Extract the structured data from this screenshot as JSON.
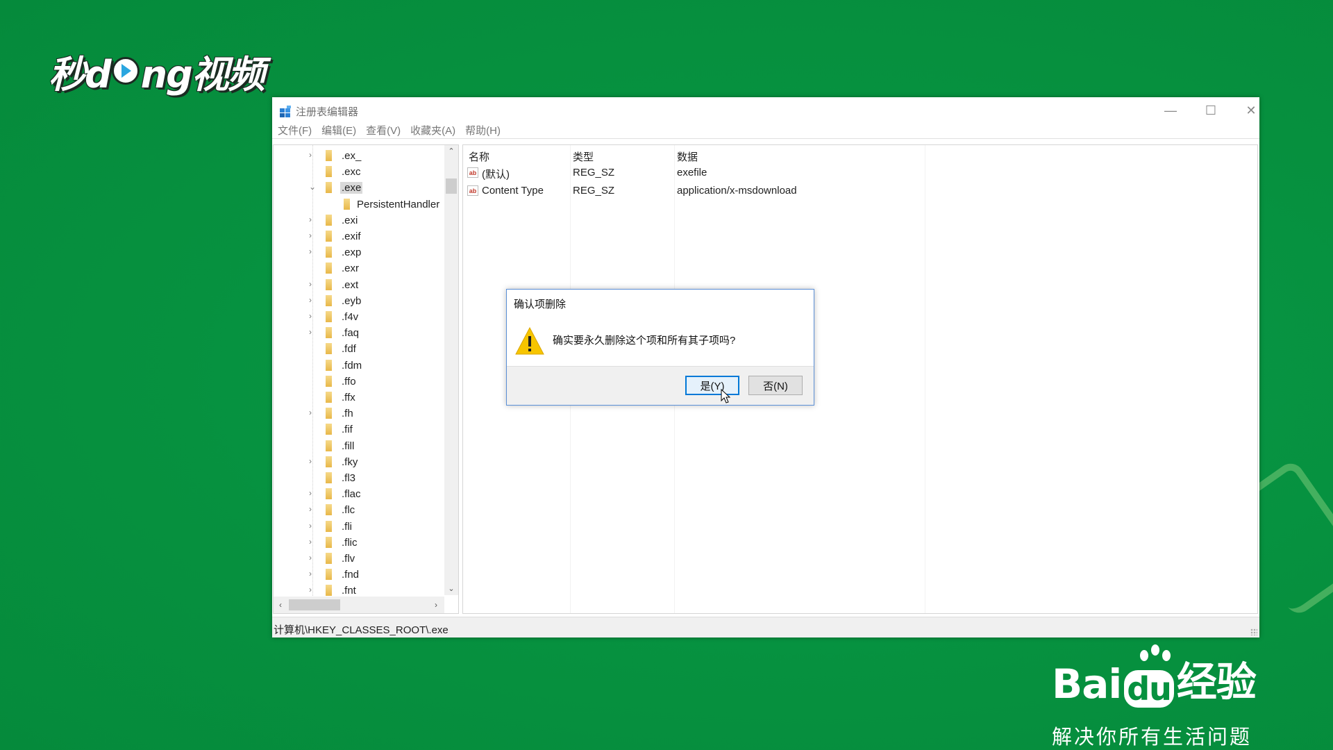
{
  "watermark": {
    "brand_left": "秒d",
    "brand_mid": "ng视频",
    "baidu_text": "Bai",
    "baidu_paw_text": "du",
    "baidu_suffix": "经验",
    "baidu_slogan": "解决你所有生活问题"
  },
  "window": {
    "title": "注册表编辑器",
    "controls": {
      "minimize": "—",
      "maximize": "☐",
      "close": "✕"
    },
    "menu": [
      "文件(F)",
      "编辑(E)",
      "查看(V)",
      "收藏夹(A)",
      "帮助(H)"
    ]
  },
  "tree": {
    "items": [
      {
        "label": ".ex_",
        "expander": "›"
      },
      {
        "label": ".exc",
        "expander": ""
      },
      {
        "label": ".exe",
        "expander": "⌄",
        "selected": true
      },
      {
        "label": "PersistentHandler",
        "expander": "",
        "child": true
      },
      {
        "label": ".exi",
        "expander": "›"
      },
      {
        "label": ".exif",
        "expander": "›"
      },
      {
        "label": ".exp",
        "expander": "›"
      },
      {
        "label": ".exr",
        "expander": ""
      },
      {
        "label": ".ext",
        "expander": "›"
      },
      {
        "label": ".eyb",
        "expander": "›"
      },
      {
        "label": ".f4v",
        "expander": "›"
      },
      {
        "label": ".faq",
        "expander": "›"
      },
      {
        "label": ".fdf",
        "expander": ""
      },
      {
        "label": ".fdm",
        "expander": ""
      },
      {
        "label": ".ffo",
        "expander": ""
      },
      {
        "label": ".ffx",
        "expander": ""
      },
      {
        "label": ".fh",
        "expander": "›"
      },
      {
        "label": ".fif",
        "expander": ""
      },
      {
        "label": ".fill",
        "expander": ""
      },
      {
        "label": ".fky",
        "expander": "›"
      },
      {
        "label": ".fl3",
        "expander": ""
      },
      {
        "label": ".flac",
        "expander": "›"
      },
      {
        "label": ".flc",
        "expander": "›"
      },
      {
        "label": ".fli",
        "expander": "›"
      },
      {
        "label": ".flic",
        "expander": "›"
      },
      {
        "label": ".flv",
        "expander": "›"
      },
      {
        "label": ".fnd",
        "expander": "›"
      },
      {
        "label": ".fnt",
        "expander": "›"
      }
    ],
    "scroll_up": "⌃",
    "scroll_down": "⌄",
    "scroll_left": "‹",
    "scroll_right": "›"
  },
  "list": {
    "headers": {
      "name": "名称",
      "type": "类型",
      "data": "数据"
    },
    "rows": [
      {
        "icon": "ab",
        "name": "(默认)",
        "type": "REG_SZ",
        "data": "exefile"
      },
      {
        "icon": "ab",
        "name": "Content Type",
        "type": "REG_SZ",
        "data": "application/x-msdownload"
      }
    ]
  },
  "status": {
    "path": "计算机\\HKEY_CLASSES_ROOT\\.exe"
  },
  "dialog": {
    "title": "确认项删除",
    "message": "确实要永久删除这个项和所有其子项吗?",
    "icon": "warning-icon",
    "yes_label": "是(Y)",
    "no_label": "否(N)"
  },
  "colors": {
    "background": "#06913f",
    "accent": "#0078d7",
    "warning": "#f7c500"
  }
}
